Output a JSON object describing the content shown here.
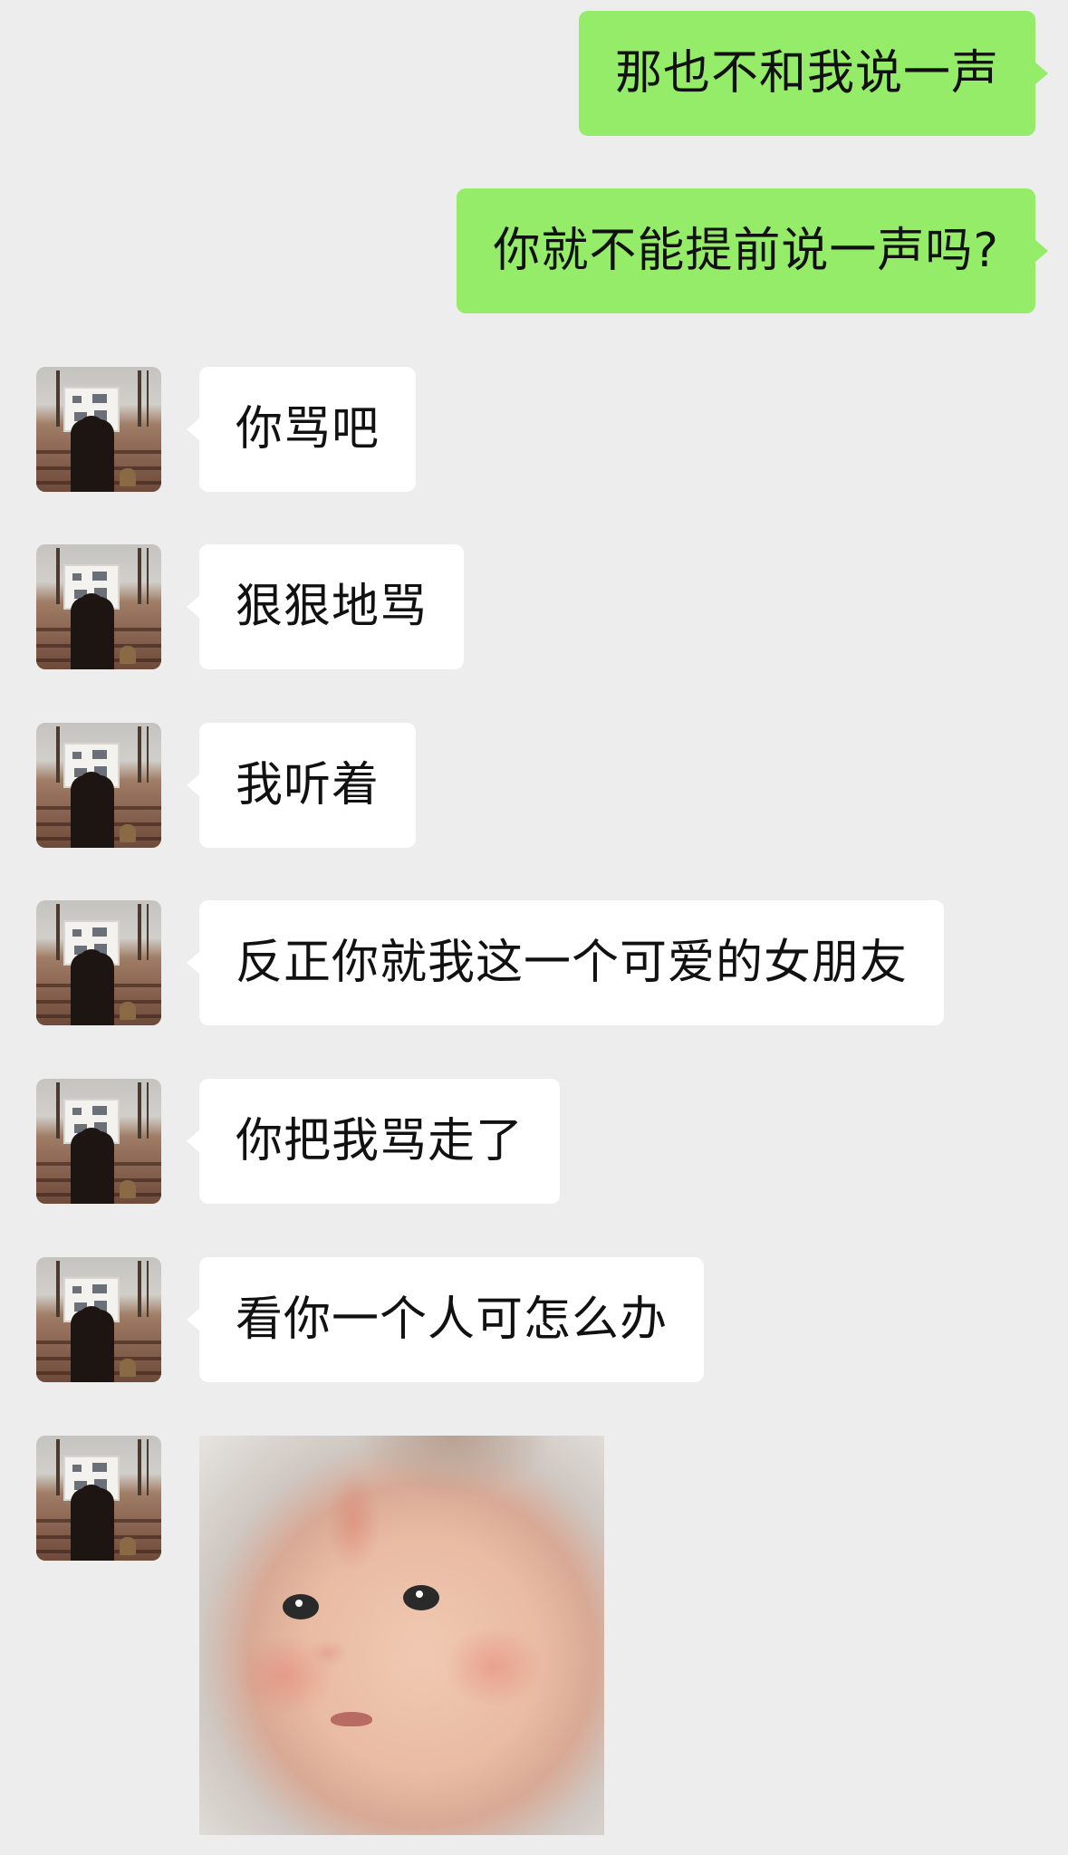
{
  "messages": [
    {
      "side": "out",
      "text": "那也不和我说一声"
    },
    {
      "side": "out",
      "text": "你就不能提前说一声吗?"
    },
    {
      "side": "in",
      "text": "你骂吧"
    },
    {
      "side": "in",
      "text": "狠狠地骂"
    },
    {
      "side": "in",
      "text": "我听着"
    },
    {
      "side": "in",
      "text": "反正你就我这一个可爱的女朋友"
    },
    {
      "side": "in",
      "text": "你把我骂走了"
    },
    {
      "side": "in",
      "text": "看你一个人可怎么办"
    },
    {
      "side": "in",
      "type": "sticker",
      "sticker": "crying-baby-sticker"
    }
  ],
  "colors": {
    "background": "#ededed",
    "outgoing_bubble": "#95ec69",
    "incoming_bubble": "#ffffff",
    "text": "#111111"
  }
}
